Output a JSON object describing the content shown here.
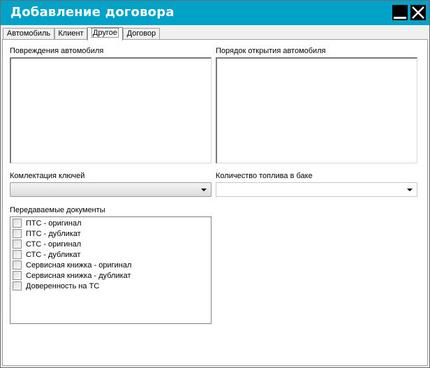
{
  "window": {
    "title": "Добавление договора"
  },
  "tabs": [
    {
      "label": "Автомобиль"
    },
    {
      "label": "Клиент"
    },
    {
      "label": "Другое"
    },
    {
      "label": "Договор"
    }
  ],
  "active_tab": "Другое",
  "panel": {
    "damage_label": "Повреждения автомобиля",
    "damage_value": "",
    "opening_label": "Порядок открытия автомобиля",
    "opening_value": "",
    "keys_label": "Комлектация ключей",
    "keys_value": "",
    "fuel_label": "Количество топлива в баке",
    "fuel_value": "",
    "docs_label": "Передаваемые документы",
    "documents": [
      {
        "label": "ПТС - оригинал",
        "checked": false
      },
      {
        "label": "ПТС - дубликат",
        "checked": false
      },
      {
        "label": "СТС - оригинал",
        "checked": false
      },
      {
        "label": "СТС - дубликат",
        "checked": false
      },
      {
        "label": "Сервисная книжка - оригинал",
        "checked": false
      },
      {
        "label": "Сервисная книжка - дубликат",
        "checked": false
      },
      {
        "label": "Доверенность на ТС",
        "checked": false
      }
    ]
  },
  "colors": {
    "titlebar": "#00a2c8",
    "title_text": "#ffffff",
    "window_bg": "#f0f0f0",
    "panel_bg": "#ffffff"
  },
  "icons": {
    "minimize": "minimize-icon",
    "close": "close-icon",
    "dropdown": "chevron-down-icon",
    "checkbox": "checkbox-icon"
  }
}
